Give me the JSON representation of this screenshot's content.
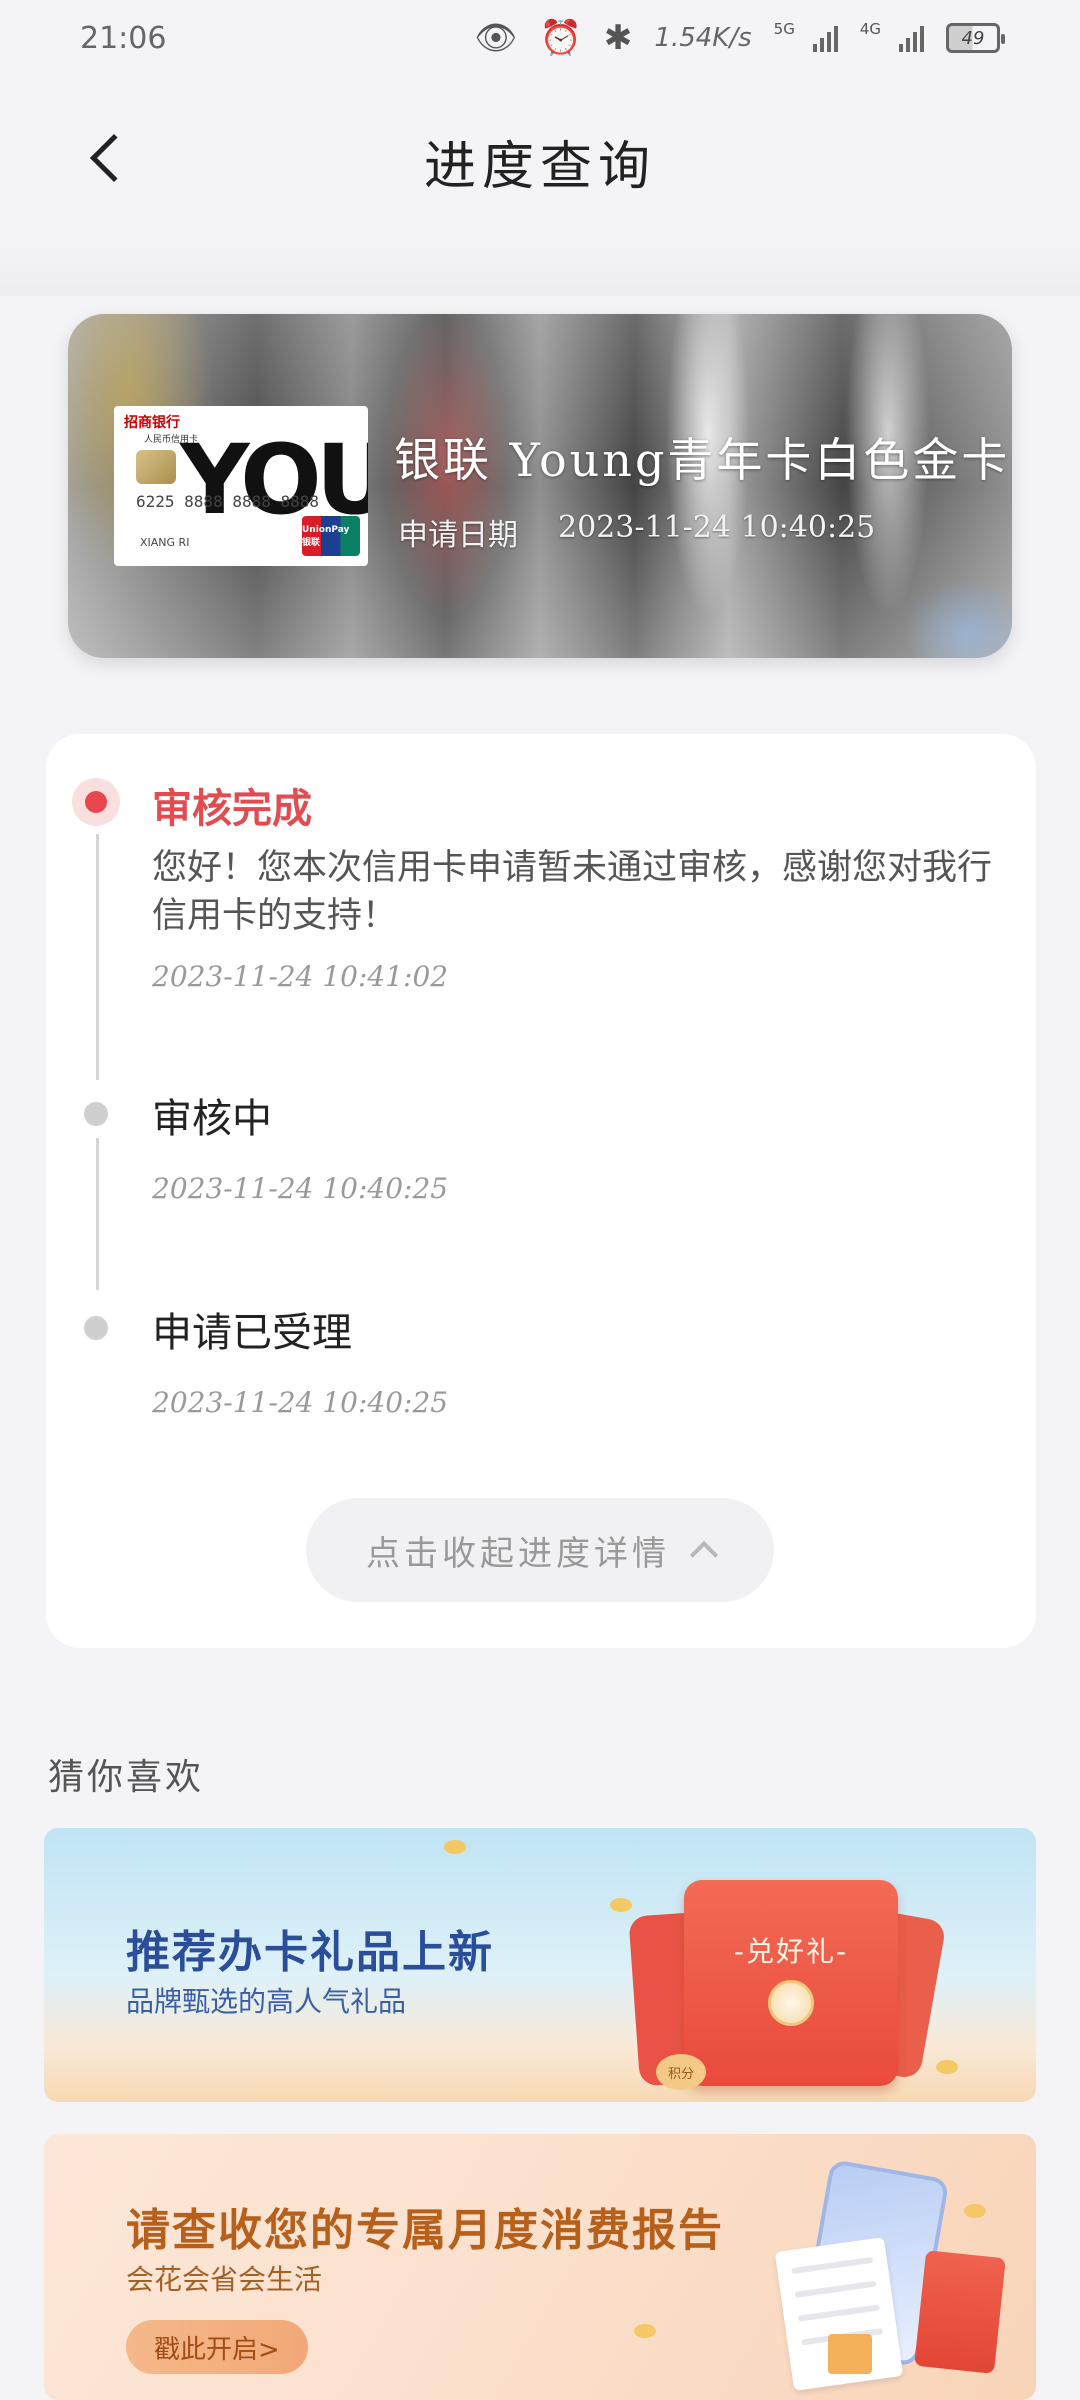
{
  "status_bar": {
    "time": "21:06",
    "speed": "1.54K/s",
    "net1": "5G",
    "net2": "4G",
    "battery": "49"
  },
  "header": {
    "title": "进度查询"
  },
  "card": {
    "name": "银联 Young青年卡白色金卡",
    "apply_date_label": "申请日期",
    "apply_date_value": "2023-11-24  10:40:25",
    "thumb": {
      "bank": "招商银行",
      "sub": "人民币信用卡",
      "brand": "YOUNG",
      "number": "6225  8888  8888  8888",
      "holder": "XIANG RI",
      "network": "UnionPay 银联"
    }
  },
  "progress": {
    "steps": [
      {
        "title": "审核完成",
        "desc": "您好！您本次信用卡申请暂未通过审核，感谢您对我行信用卡的支持！",
        "time": "2023-11-24  10:41:02"
      },
      {
        "title": "审核中",
        "time": "2023-11-24  10:40:25"
      },
      {
        "title": "申请已受理",
        "time": "2023-11-24  10:40:25"
      }
    ],
    "collapse_label": "点击收起进度详情"
  },
  "recommend": {
    "title": "猜你喜欢",
    "banners": [
      {
        "title": "推荐办卡礼品上新",
        "subtitle": "品牌甄选的高人气礼品",
        "badge": "-兑好礼-",
        "coin_label": "积分"
      },
      {
        "title": "请查收您的专属月度消费报告",
        "subtitle": "会花会省会生活",
        "cta": "戳此开启>"
      }
    ]
  }
}
